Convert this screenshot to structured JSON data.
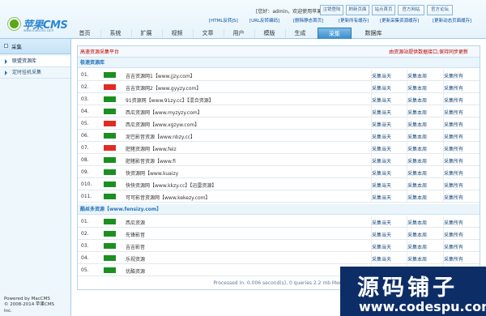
{
  "header": {
    "logo_text": "苹果CMS",
    "logo_sub": "www.maccms.com",
    "welcome": "[您好：admin，欢迎使用苹果CMS]",
    "user": "admin",
    "top_buttons": [
      "注销登陆",
      "刷新页面",
      "站点首页",
      "官方网站",
      "官方论坛"
    ],
    "quick_links": [
      "[HTML反转JS]",
      "[URL反转编码]",
      "[删除静态首页]",
      "[更新所有缓存]",
      "[更新采集资源缓存]",
      "[更新动态页面缓存]"
    ]
  },
  "nav": {
    "items": [
      "首页",
      "系统",
      "扩展",
      "视频",
      "文章",
      "用户",
      "模版",
      "生成",
      "采集",
      "数据库"
    ],
    "active_index": 8
  },
  "sidebar": {
    "title": "采集",
    "items": [
      "联盟资源库",
      "定时挂机采集"
    ],
    "active_index": 0
  },
  "powered": {
    "line1": "Powered by MacCMS",
    "line2": "© 2008-2014 苹果CMS",
    "line3": "Inc."
  },
  "main": {
    "header_left": "高速资源采集平台",
    "header_right": "由资源站提供数据接口,保持同步更新",
    "section1": {
      "title": "极速资源库",
      "rows": [
        {
          "num": "01.",
          "status_color": "#1c8f22",
          "site": "吉吉资源网1【www.jjzy.com】",
          "acts": [
            "采集当天",
            "采集本周",
            "采集所有"
          ]
        },
        {
          "num": "02.",
          "status_color": "#e02b25",
          "site": "吉吉资源网2【www.gyyzy.com】",
          "acts": [
            "采集当天",
            "采集本周",
            "采集所有"
          ]
        },
        {
          "num": "03.",
          "status_color": "#1c8f22",
          "site": "91资源网【www.91zy.cc】【混合资源】",
          "acts": [
            "采集当天",
            "采集本周",
            "采集所有"
          ]
        },
        {
          "num": "04.",
          "status_color": "#1c8f22",
          "site": "西瓜资源网【www.myzyzy.com】",
          "acts": [
            "采集当天",
            "采集本周",
            "采集所有"
          ]
        },
        {
          "num": "05.",
          "status_color": "#e02b25",
          "site": "西瓜资源网【www.xgzyw.com】",
          "acts": [
            "采集当天",
            "采集本周",
            "采集所有"
          ]
        },
        {
          "num": "06.",
          "status_color": "#1c8f22",
          "site": "泥巴影音资源【www.nbzy.cc】",
          "acts": [
            "采集当天",
            "采集本周",
            "采集所有"
          ]
        },
        {
          "num": "07.",
          "status_color": "#e02b25",
          "site": "肥猪资源网【www.feiz",
          "acts": [
            "采集当天",
            "采集本周",
            "采集所有"
          ]
        },
        {
          "num": "08.",
          "status_color": "#1c8f22",
          "site": "肥猪影音资源【www.fi",
          "acts": [
            "采集当天",
            "采集本周",
            "采集所有"
          ]
        },
        {
          "num": "09.",
          "status_color": "#1c8f22",
          "site": "快资源网【www.kuaizy",
          "acts": [
            "采集当天",
            "采集本周",
            "采集所有"
          ]
        },
        {
          "num": "010.",
          "status_color": "#1c8f22",
          "site": "快快资源网【www.kkzy.cc】【迅雷资源】",
          "acts": [
            "采集当天",
            "采集本周",
            "采集所有"
          ]
        },
        {
          "num": "011.",
          "status_color": "#1c8f22",
          "site": "可可影音资源网【www.kekezy.com】",
          "acts": [
            "采集当天",
            "采集本周",
            "采集所有"
          ]
        }
      ]
    },
    "section2": {
      "title": "酷丝多资源【www.fensizy.com】",
      "rows": [
        {
          "num": "01.",
          "status_color": "#1c8f22",
          "site": "西瓜资源",
          "acts": [
            "采集当天",
            "采集本周",
            "采集所有"
          ]
        },
        {
          "num": "02.",
          "status_color": "#1c8f22",
          "site": "先锋影音",
          "acts": [
            "采集当天",
            "采集本周",
            "采集所有"
          ]
        },
        {
          "num": "03.",
          "status_color": "#1c8f22",
          "site": "吉吉影音",
          "acts": [
            "采集当天",
            "采集本周",
            "采集所有"
          ]
        },
        {
          "num": "04.",
          "status_color": "#1c8f22",
          "site": "乐视资源",
          "acts": [
            "采集当天",
            "采集本周",
            "采集所有"
          ]
        },
        {
          "num": "05.",
          "status_color": "#1c8f22",
          "site": "优酷资源",
          "acts": [
            "采集当天",
            "采集本周",
            "采集所有"
          ]
        }
      ]
    },
    "processed": "Processed in: 0.006 second(s), 0 queries 2.2 mb Mem"
  },
  "watermark": {
    "text": "源码铺子",
    "url": "www.codespu.com"
  }
}
